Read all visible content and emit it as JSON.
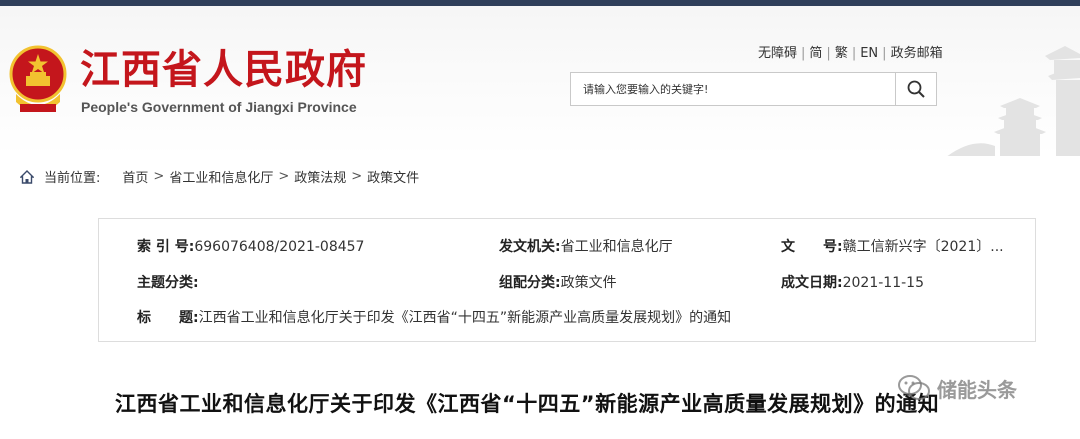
{
  "header": {
    "site_name_cn": "江西省人民政府",
    "site_name_en": "People's Government of Jiangxi Province",
    "util_links": [
      "无障碍",
      "简",
      "繁",
      "EN",
      "政务邮箱"
    ],
    "search_placeholder": "请输入您要输入的关键字!"
  },
  "breadcrumb": {
    "label": "当前位置:",
    "items": [
      "首页",
      "省工业和信息化厅",
      "政策法规",
      "政策文件"
    ],
    "separator": ">"
  },
  "meta": {
    "index_label": "索 引 号:",
    "index_value": "696076408/2021-08457",
    "issuer_label": "发文机关:",
    "issuer_value": "省工业和信息化厅",
    "docno_label": "文　　号:",
    "docno_value": "赣工信新兴字〔2021〕...",
    "topic_label": "主题分类:",
    "topic_value": "",
    "category_label": "组配分类:",
    "category_value": "政策文件",
    "date_label": "成文日期:",
    "date_value": "2021-11-15",
    "title_label": "标　　题:",
    "title_value": "江西省工业和信息化厅关于印发《江西省“十四五”新能源产业高质量发展规划》的通知"
  },
  "document": {
    "title": "江西省工业和信息化厅关于印发《江西省“十四五”新能源产业高质量发展规划》的通知"
  },
  "watermark": {
    "text": "储能头条"
  },
  "colors": {
    "brand_red": "#c4161c",
    "top_bar": "#2f3f5a",
    "emblem_gold": "#f2c230"
  },
  "icons": [
    "emblem-icon",
    "search-icon",
    "home-icon",
    "wechat-icon"
  ]
}
